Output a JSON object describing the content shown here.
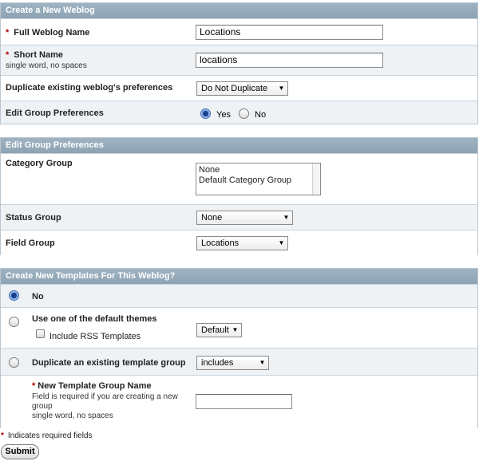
{
  "create_weblog": {
    "title": "Create a New Weblog",
    "full_name_label": "Full Weblog Name",
    "full_name_value": "Locations",
    "short_name_label": "Short Name",
    "short_name_hint": "single word, no spaces",
    "short_name_value": "locations",
    "duplicate_label": "Duplicate existing weblog's preferences",
    "duplicate_selected": "Do Not Duplicate",
    "edit_group_label": "Edit Group Preferences",
    "yes_label": "Yes",
    "no_label": "No",
    "edit_group_selected": "yes",
    "required_marker": "*"
  },
  "group_prefs": {
    "title": "Edit Group Preferences",
    "category_label": "Category Group",
    "category_options": [
      "None",
      "Default Category Group"
    ],
    "status_label": "Status Group",
    "status_selected": "None",
    "field_label": "Field Group",
    "field_selected": "Locations"
  },
  "templates": {
    "title": "Create New Templates For This Weblog?",
    "no_label": "No",
    "default_theme_label": "Use one of the default themes",
    "include_rss_label": "Include RSS Templates",
    "theme_selected": "Default",
    "duplicate_group_label": "Duplicate an existing template group",
    "duplicate_group_selected": "includes",
    "new_group_label": "New Template Group Name",
    "new_group_hint_1": "Field is required if you are creating a new",
    "new_group_hint_2": "group",
    "new_group_hint_3": "single word, no spaces",
    "new_group_value": "",
    "selected_option": "no"
  },
  "footer": {
    "required_note": "Indicates required fields",
    "submit_label": "Submit"
  },
  "colors": {
    "header_bg": "#9fb3c2",
    "row_alt_bg": "#eef2f5",
    "required_red": "#b00000"
  }
}
